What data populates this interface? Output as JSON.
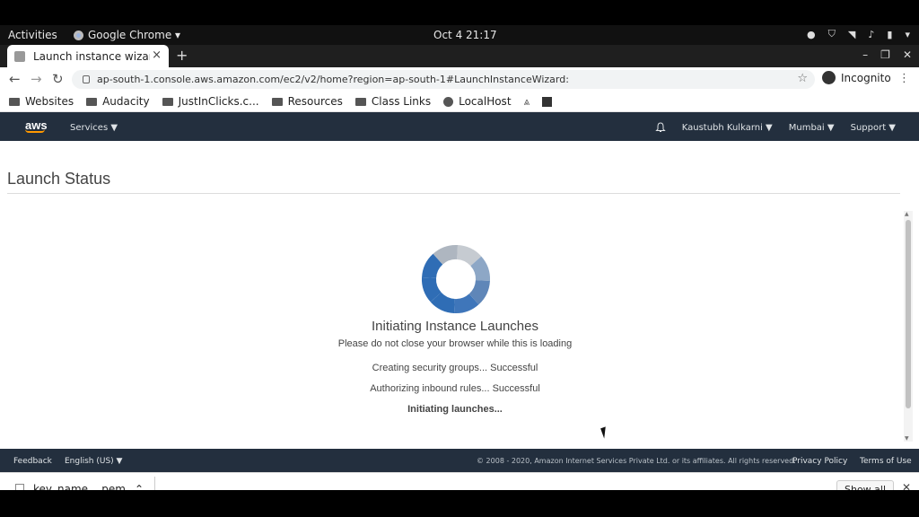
{
  "system_bar": {
    "activities": "Activities",
    "app_name": "Google Chrome ▾",
    "clock": "Oct 4  21:17"
  },
  "browser": {
    "tab_title": "Launch instance wizard | E",
    "tab_close": "×",
    "new_tab": "+",
    "url": "ap-south-1.console.aws.amazon.com/ec2/v2/home?region=ap-south-1#LaunchInstanceWizard:",
    "incognito_label": "Incognito",
    "bookmarks": [
      {
        "label": "Websites",
        "icon": "folder-icon"
      },
      {
        "label": "Audacity",
        "icon": "folder-icon"
      },
      {
        "label": "JustInClicks.c...",
        "icon": "folder-icon"
      },
      {
        "label": "Resources",
        "icon": "folder-icon"
      },
      {
        "label": "Class Links",
        "icon": "folder-icon"
      },
      {
        "label": "LocalHost",
        "icon": "globe-icon"
      }
    ]
  },
  "aws_nav": {
    "logo": "aws",
    "services": "Services ▼",
    "user": "Kaustubh Kulkarni ▼",
    "region": "Mumbai ▼",
    "support": "Support ▼"
  },
  "main": {
    "page_title": "Launch Status",
    "heading": "Initiating Instance Launches",
    "subheading": "Please do not close your browser while this is loading",
    "steps": [
      "Creating security groups... Successful",
      "Authorizing inbound rules... Successful",
      "Initiating launches..."
    ]
  },
  "aws_footer": {
    "feedback": "Feedback",
    "language": "English (US) ▼",
    "copyright": "© 2008 - 2020, Amazon Internet Services Private Ltd. or its affiliates. All rights reserved.",
    "privacy": "Privacy Policy",
    "terms": "Terms of Use"
  },
  "downloads": {
    "file": "key_name....pem",
    "show_all": "Show all"
  },
  "colors": {
    "aws_nav_bg": "#232f3e",
    "aws_orange": "#ff9900",
    "spinner_blue": "#2f6db5",
    "spinner_grey": "#c6cbd1"
  }
}
